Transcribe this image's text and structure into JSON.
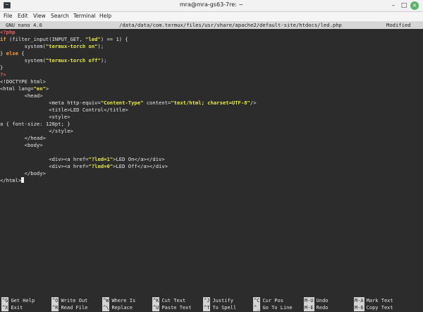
{
  "window": {
    "title": "mra@mra-gs63-7re: ~",
    "minimize_glyph": "–",
    "maximize_glyph": "□",
    "close_glyph": "×",
    "icons": {
      "app": "terminal-icon",
      "minimize": "minimize-icon",
      "maximize": "maximize-icon",
      "close": "close-icon"
    }
  },
  "menu": [
    "File",
    "Edit",
    "View",
    "Search",
    "Terminal",
    "Help"
  ],
  "nano": {
    "version": "GNU nano 4.6",
    "filepath": "/data/data/com.termux/files/usr/share/apache2/default-site/htdocs/led.php",
    "status": "Modified"
  },
  "code": {
    "l1": "<?php",
    "l2_a": "if",
    "l2_b": " (filter_input(INPUT_GET, ",
    "l2_c": "\"led\"",
    "l2_d": ") == 1) {",
    "l3_a": "        system(",
    "l3_b": "\"termux-torch on\"",
    "l3_c": ");",
    "l4_a": "} ",
    "l4_b": "else",
    "l4_c": " {",
    "l5_a": "        system(",
    "l5_b": "\"termux-torch off\"",
    "l5_c": ");",
    "l6": "}",
    "l7": "?>",
    "l8": "<!DOCTYPE html>",
    "l9_a": "<html lang=",
    "l9_b": "\"en\"",
    "l9_c": ">",
    "l10": "        <head>",
    "l11_a": "                <meta http-equiv=",
    "l11_b": "\"Content-Type\"",
    "l11_c": " content=",
    "l11_d": "\"text/html; charset=UTF-8\"",
    "l11_e": "/>",
    "l12": "                <title>LED Control</title>",
    "l13": "                <style>",
    "l14": "a { font-size: 128pt; }",
    "l15": "                </style>",
    "l16": "        </head>",
    "l17": "        <body>",
    "l18_a": "                <div><a href=",
    "l18_b": "\"?led=1\"",
    "l18_c": ">LED On</a></div>",
    "l19_a": "                <div><a href=",
    "l19_b": "\"?led=0\"",
    "l19_c": ">LED Off</a></div>",
    "l20": "        </body>",
    "l21": "</html>"
  },
  "shortcuts": [
    {
      "key": "^G",
      "label": "Get Help"
    },
    {
      "key": "^O",
      "label": "Write Out"
    },
    {
      "key": "^W",
      "label": "Where Is"
    },
    {
      "key": "^K",
      "label": "Cut Text"
    },
    {
      "key": "^J",
      "label": "Justify"
    },
    {
      "key": "^C",
      "label": "Cur Pos"
    },
    {
      "key": "M-U",
      "label": "Undo"
    },
    {
      "key": "M-A",
      "label": "Mark Text"
    },
    {
      "key": "^X",
      "label": "Exit"
    },
    {
      "key": "^R",
      "label": "Read File"
    },
    {
      "key": "^\\",
      "label": "Replace"
    },
    {
      "key": "^U",
      "label": "Paste Text"
    },
    {
      "key": "^T",
      "label": "To Spell"
    },
    {
      "key": "^_",
      "label": "Go To Line"
    },
    {
      "key": "M-E",
      "label": "Redo"
    },
    {
      "key": "M-6",
      "label": "Copy Text"
    }
  ]
}
